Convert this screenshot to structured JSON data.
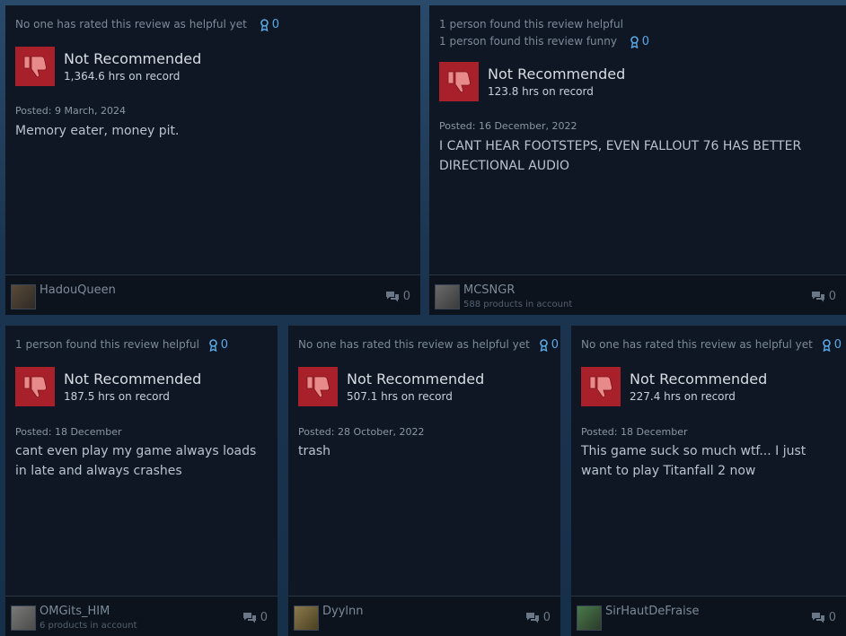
{
  "reviews": [
    {
      "helpful": "No one has rated this review as helpful yet",
      "funny": "",
      "awards": "0",
      "verdict": "Not Recommended",
      "hours": "1,364.6 hrs on record",
      "posted": "Posted: 9 March, 2024",
      "body": "Memory eater, money pit.",
      "author": "HadouQueen",
      "products": "",
      "comments": "0"
    },
    {
      "helpful": "1 person found this review helpful",
      "funny": "1 person found this review funny",
      "awards": "0",
      "verdict": "Not Recommended",
      "hours": "123.8 hrs on record",
      "posted": "Posted: 16 December, 2022",
      "body": "I CANT HEAR FOOTSTEPS, EVEN FALLOUT 76 HAS BETTER DIRECTIONAL AUDIO",
      "author": "MCSNGR",
      "products": "588 products in account",
      "comments": "0"
    },
    {
      "helpful": "1 person found this review helpful",
      "funny": "",
      "awards": "0",
      "verdict": "Not Recommended",
      "hours": "187.5 hrs on record",
      "posted": "Posted: 18 December",
      "body": "cant even play my game always loads in late and always crashes",
      "author": "OMGits_HIM",
      "products": "6 products in account",
      "comments": "0"
    },
    {
      "helpful": "No one has rated this review as helpful yet",
      "funny": "",
      "awards": "0",
      "verdict": "Not Recommended",
      "hours": "507.1 hrs on record",
      "posted": "Posted: 28 October, 2022",
      "body": "trash",
      "author": "Dyylnn",
      "products": "",
      "comments": "0"
    },
    {
      "helpful": "No one has rated this review as helpful yet",
      "funny": "",
      "awards": "0",
      "verdict": "Not Recommended",
      "hours": "227.4 hrs on record",
      "posted": "Posted: 18 December",
      "body": "This game suck so much wtf... I just want to play Titanfall 2 now",
      "author": "SirHautDeFraise",
      "products": "",
      "comments": "0"
    }
  ],
  "colors": {
    "thumb_bg": "#a8212a",
    "award": "#5aa9e6",
    "card_bg": "#0f1724"
  }
}
